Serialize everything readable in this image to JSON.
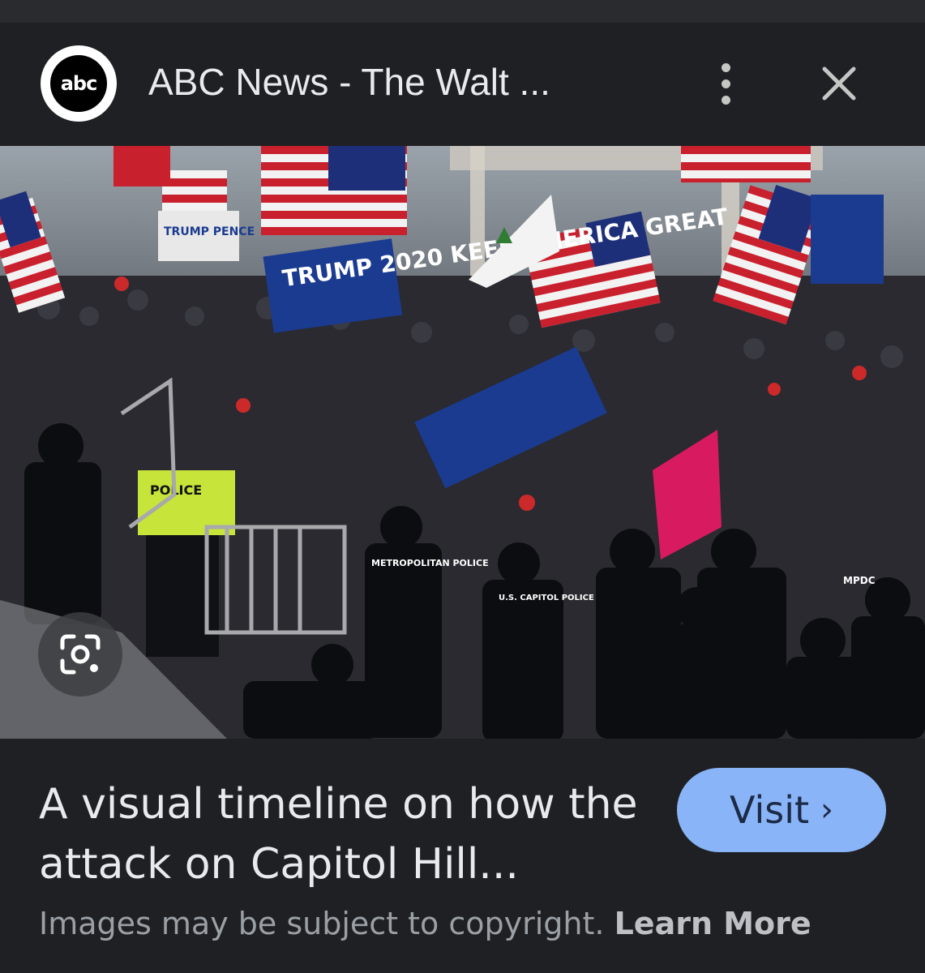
{
  "header": {
    "logo_text": "abc",
    "source_title": "ABC News - The Walt ...",
    "more_icon": "more-vertical-icon",
    "close_icon": "close-icon"
  },
  "image": {
    "description_icon": "lens-search-icon",
    "signs": [
      "TRUMP 2020 KEEP AMERICA GREAT",
      "TRUMP PENCE",
      "POLICE",
      "METROPOLITAN POLICE",
      "U.S. CAPITOL POLICE",
      "MPDC"
    ]
  },
  "footer": {
    "headline": "A visual timeline on how the attack on Capitol Hill...",
    "visit_label": "Visit",
    "visit_chevron": "›",
    "copyright_text": "Images may be subject to copyright.",
    "learn_more": "Learn More"
  },
  "colors": {
    "background": "#1f2023",
    "accent": "#8ab4f8",
    "text": "#e8eaed",
    "muted": "#9aa0a6"
  }
}
